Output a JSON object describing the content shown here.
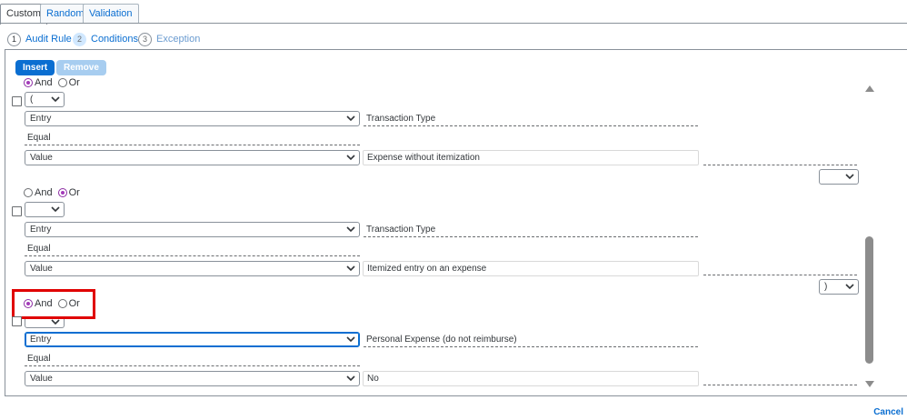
{
  "tabs": [
    {
      "label": "Custom",
      "active": true
    },
    {
      "label": "Random",
      "active": false
    },
    {
      "label": "Validation",
      "active": false
    }
  ],
  "steps": [
    {
      "number": "1",
      "label": "Audit Rule"
    },
    {
      "number": "2",
      "label": "Conditions"
    },
    {
      "number": "3",
      "label": "Exception"
    }
  ],
  "toolbar": {
    "insert_label": "Insert",
    "remove_label": "Remove"
  },
  "radio_labels": {
    "and": "And",
    "or": "Or"
  },
  "conditions": [
    {
      "logic": "And",
      "open_paren": "(",
      "type_select": "Entry",
      "field_label": "Transaction Type",
      "operator": "Equal",
      "value_select": "Value",
      "value_input": "Expense without itemization",
      "close_paren": ""
    },
    {
      "logic": "Or",
      "open_paren": "",
      "type_select": "Entry",
      "field_label": "Transaction Type",
      "operator": "Equal",
      "value_select": "Value",
      "value_input": "Itemized entry on an expense",
      "close_paren": ")"
    },
    {
      "logic": "And",
      "open_paren": "",
      "type_select": "Entry",
      "field_label": "Personal Expense  (do not reimburse)",
      "operator": "Equal",
      "value_select": "Value",
      "value_input": "No",
      "close_paren": ""
    }
  ],
  "footer": {
    "cancel_label": "Cancel"
  },
  "colors": {
    "accent": "#0a6ed1",
    "radio_selected": "#a33ab9",
    "highlight": "#e00000"
  }
}
